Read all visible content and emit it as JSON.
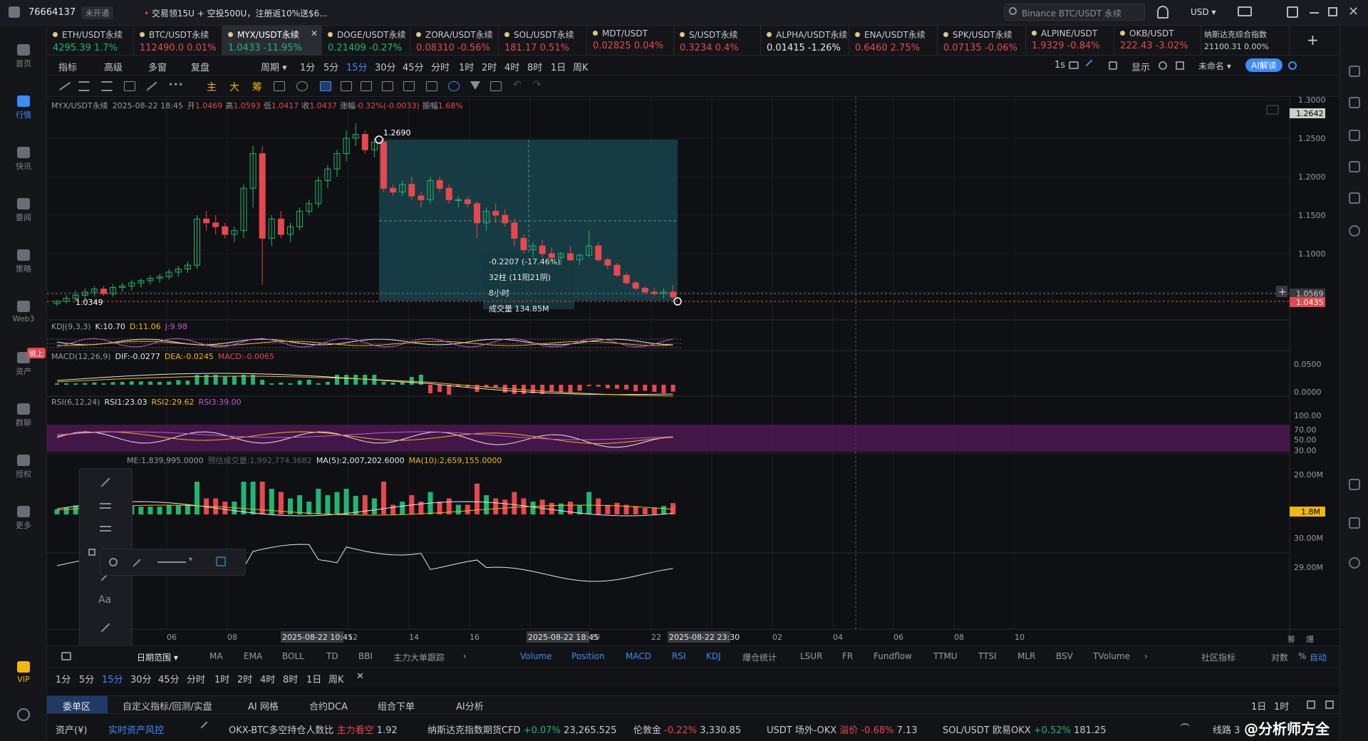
{
  "titlebar": {
    "account": "76664137",
    "badge": "未开通",
    "promo": "交易领15U + 空投500U，注册返10%送$6...",
    "search_placeholder": "Binance BTC/USDT 永续",
    "currency": "USD"
  },
  "leftnav": [
    {
      "label": "首页",
      "icon": "home-icon"
    },
    {
      "label": "行情",
      "icon": "market-icon",
      "active": true
    },
    {
      "label": "快讯",
      "icon": "news-flash-icon"
    },
    {
      "label": "要闻",
      "icon": "headlines-icon"
    },
    {
      "label": "策略",
      "icon": "strategy-icon"
    },
    {
      "label": "Web3",
      "icon": "web3-icon"
    },
    {
      "label": "资产",
      "icon": "wallet-icon",
      "tag": "链上"
    },
    {
      "label": "群聊",
      "icon": "chat-icon"
    },
    {
      "label": "授权",
      "icon": "authorize-icon"
    },
    {
      "label": "更多",
      "icon": "more-icon"
    },
    {
      "label": "VIP",
      "icon": "vip-icon"
    }
  ],
  "tickers": [
    {
      "name": "ETH/USDT永续",
      "price": "4295.39",
      "change": "1.7%",
      "dir": "up"
    },
    {
      "name": "BTC/USDT永续",
      "price": "112490.0",
      "change": "0.01%",
      "dir": "dn"
    },
    {
      "name": "MYX/USDT永续",
      "price": "1.0433",
      "change": "-11.95%",
      "dir": "up",
      "selected": true
    },
    {
      "name": "DOGE/USDT永续",
      "price": "0.21409",
      "change": "-0.27%",
      "dir": "up"
    },
    {
      "name": "ZORA/USDT永续",
      "price": "0.08310",
      "change": "-0.56%",
      "dir": "dn"
    },
    {
      "name": "SOL/USDT永续",
      "price": "181.17",
      "change": "0.51%",
      "dir": "dn"
    },
    {
      "name": "MDT/USDT",
      "price": "0.02825",
      "change": "0.04%",
      "dir": "dn"
    },
    {
      "name": "S/USDT永续",
      "price": "0.3234",
      "change": "0.4%",
      "dir": "dn"
    },
    {
      "name": "ALPHA/USDT永续",
      "price": "0.01415",
      "change": "-1.26%",
      "dir": "neutral"
    },
    {
      "name": "ENA/USDT永续",
      "price": "0.6460",
      "change": "2.75%",
      "dir": "dn"
    },
    {
      "name": "SPK/USDT永续",
      "price": "0.07135",
      "change": "-0.06%",
      "dir": "dn"
    },
    {
      "name": "ALPINE/USDT",
      "price": "1.9329",
      "change": "-0.84%",
      "dir": "dn"
    },
    {
      "name": "OKB/USDT",
      "price": "222.43",
      "change": "-3.02%",
      "dir": "dn"
    },
    {
      "name": "纳斯达克综合指数",
      "price": "21100.31",
      "change": "0.00%",
      "dir": "neutral"
    }
  ],
  "toolbar1": {
    "items": [
      "指标",
      "高级",
      "多窗",
      "复盘",
      "周期"
    ],
    "timeframes": [
      "1分",
      "5分",
      "15分",
      "30分",
      "45分",
      "分时",
      "1时",
      "2时",
      "4时",
      "8时",
      "1日",
      "周K"
    ],
    "selected_tf": "15分",
    "right": [
      "1s",
      "显示",
      "未命名",
      "AI解读"
    ]
  },
  "toolbar2": {
    "tags": [
      "主",
      "大",
      "筹"
    ]
  },
  "chart": {
    "symbol_line": {
      "symbol": "MYX/USDT永续",
      "time": "2025-08-22 18:45",
      "open_l": "开",
      "open": "1.0469",
      "high_l": "高",
      "high": "1.0593",
      "low_l": "低",
      "low": "1.0417",
      "close_l": "收",
      "close": "1.0437",
      "chg_l": "涨幅",
      "chg": "-0.32%(-0.0033)",
      "amp_l": "振幅",
      "amp": "1.68%"
    },
    "price_axis": [
      "1.3000",
      "1.2500",
      "1.2000",
      "1.1500",
      "1.1000",
      "1.0500"
    ],
    "price_tags": {
      "high_mark": "1.2642",
      "ref": "1.0569",
      "last": "1.0435"
    },
    "hi_label": "1.2690",
    "lo_label": "1.0349",
    "measure": {
      "l1": "-0.2207 (-17.46%)",
      "l2": "32柱 (11阳21阴)",
      "l3": "8小时",
      "l4": "成交量 134.85M"
    },
    "kdj": {
      "name": "KDJ(9,3,3)",
      "k": "K:10.70",
      "d": "D:11.06",
      "j": "J:9.98"
    },
    "macd": {
      "name": "MACD(12,26,9)",
      "dif": "DIF:-0.0277",
      "dea": "DEA:-0.0245",
      "macd": "MACD:-0.0065",
      "axis": [
        "0.0500",
        "0.0000"
      ]
    },
    "rsi": {
      "name": "RSI(6,12,24)",
      "r1": "RSI1:23.03",
      "r2": "RSI2:29.62",
      "r3": "RSI3:39.00",
      "axis": [
        "100.00",
        "70.00",
        "50.00",
        "30.00"
      ]
    },
    "vol": {
      "v": "ME:1,839,995.0000",
      "est": "预估成交量:1,992,774.3682",
      "ma5": "MA(5):2,007,202.6000",
      "ma10": "MA(10):2,659,155.0000",
      "axis": [
        "20.00M"
      ],
      "tag": "1.8M"
    },
    "pos": {
      "axis": [
        "30.00M",
        "29.00M"
      ]
    },
    "time_axis": [
      "06",
      "08",
      "2025-08-22 10:45",
      "12",
      "14",
      "16",
      "2025-08-22 18:45",
      "20",
      "22",
      "2025-08-22 23:30",
      "02",
      "04",
      "06",
      "08",
      "10"
    ],
    "corner": [
      "筹",
      "爆"
    ]
  },
  "chart_data": {
    "type": "candlestick",
    "symbol": "MYX/USDT永续",
    "interval": "15分",
    "ylim": [
      1.02,
      1.31
    ],
    "candles": [
      [
        1.035,
        1.04,
        1.032,
        1.038
      ],
      [
        1.038,
        1.046,
        1.035,
        1.042
      ],
      [
        1.042,
        1.052,
        1.038,
        1.046
      ],
      [
        1.046,
        1.055,
        1.041,
        1.05
      ],
      [
        1.05,
        1.058,
        1.044,
        1.054
      ],
      [
        1.054,
        1.058,
        1.045,
        1.048
      ],
      [
        1.048,
        1.06,
        1.044,
        1.056
      ],
      [
        1.056,
        1.062,
        1.05,
        1.058
      ],
      [
        1.058,
        1.066,
        1.052,
        1.062
      ],
      [
        1.062,
        1.068,
        1.056,
        1.065
      ],
      [
        1.065,
        1.072,
        1.06,
        1.068
      ],
      [
        1.068,
        1.074,
        1.062,
        1.07
      ],
      [
        1.07,
        1.08,
        1.066,
        1.076
      ],
      [
        1.076,
        1.084,
        1.07,
        1.08
      ],
      [
        1.08,
        1.09,
        1.075,
        1.085
      ],
      [
        1.085,
        1.15,
        1.08,
        1.145
      ],
      [
        1.145,
        1.155,
        1.13,
        1.14
      ],
      [
        1.14,
        1.15,
        1.125,
        1.135
      ],
      [
        1.135,
        1.14,
        1.12,
        1.125
      ],
      [
        1.125,
        1.135,
        1.115,
        1.13
      ],
      [
        1.13,
        1.19,
        1.12,
        1.185
      ],
      [
        1.185,
        1.24,
        1.16,
        1.23
      ],
      [
        1.23,
        1.24,
        1.06,
        1.12
      ],
      [
        1.12,
        1.15,
        1.11,
        1.145
      ],
      [
        1.145,
        1.155,
        1.12,
        1.125
      ],
      [
        1.125,
        1.14,
        1.115,
        1.135
      ],
      [
        1.135,
        1.16,
        1.13,
        1.155
      ],
      [
        1.155,
        1.17,
        1.15,
        1.165
      ],
      [
        1.165,
        1.2,
        1.16,
        1.195
      ],
      [
        1.195,
        1.215,
        1.185,
        1.21
      ],
      [
        1.21,
        1.235,
        1.2,
        1.23
      ],
      [
        1.23,
        1.26,
        1.22,
        1.25
      ],
      [
        1.25,
        1.269,
        1.24,
        1.255
      ],
      [
        1.255,
        1.26,
        1.23,
        1.235
      ],
      [
        1.235,
        1.25,
        1.225,
        1.245
      ],
      [
        1.245,
        1.25,
        1.18,
        1.185
      ],
      [
        1.185,
        1.19,
        1.175,
        1.18
      ],
      [
        1.18,
        1.195,
        1.175,
        1.19
      ],
      [
        1.19,
        1.2,
        1.17,
        1.175
      ],
      [
        1.175,
        1.18,
        1.16,
        1.17
      ],
      [
        1.17,
        1.2,
        1.165,
        1.195
      ],
      [
        1.195,
        1.2,
        1.18,
        1.185
      ],
      [
        1.185,
        1.19,
        1.165,
        1.17
      ],
      [
        1.17,
        1.175,
        1.16,
        1.17
      ],
      [
        1.17,
        1.175,
        1.16,
        1.165
      ],
      [
        1.165,
        1.168,
        1.12,
        1.14
      ],
      [
        1.14,
        1.16,
        1.13,
        1.155
      ],
      [
        1.155,
        1.165,
        1.14,
        1.15
      ],
      [
        1.15,
        1.158,
        1.135,
        1.14
      ],
      [
        1.14,
        1.145,
        1.11,
        1.12
      ],
      [
        1.12,
        1.125,
        1.1,
        1.105
      ],
      [
        1.105,
        1.115,
        1.095,
        1.11
      ],
      [
        1.11,
        1.118,
        1.095,
        1.1
      ],
      [
        1.1,
        1.108,
        1.09,
        1.095
      ],
      [
        1.095,
        1.102,
        1.085,
        1.1
      ],
      [
        1.1,
        1.11,
        1.09,
        1.092
      ],
      [
        1.092,
        1.1,
        1.085,
        1.098
      ],
      [
        1.098,
        1.13,
        1.095,
        1.11
      ],
      [
        1.11,
        1.115,
        1.09,
        1.092
      ],
      [
        1.092,
        1.095,
        1.08,
        1.085
      ],
      [
        1.085,
        1.088,
        1.07,
        1.072
      ],
      [
        1.072,
        1.075,
        1.06,
        1.062
      ],
      [
        1.062,
        1.065,
        1.052,
        1.055
      ],
      [
        1.055,
        1.058,
        1.048,
        1.05
      ],
      [
        1.05,
        1.056,
        1.045,
        1.048
      ],
      [
        1.048,
        1.055,
        1.042,
        1.05
      ],
      [
        1.05,
        1.0593,
        1.0417,
        1.0437
      ]
    ]
  },
  "bottom": {
    "tabs_left": [
      "日期范围",
      "MA",
      "EMA",
      "BOLL",
      "TD",
      "BBI",
      "主力大单跟踪"
    ],
    "tabs_right": [
      "Volume",
      "Position",
      "MACD",
      "RSI",
      "KDJ",
      "爆仓统计",
      "LSUR",
      "FR",
      "Fundflow",
      "TTMU",
      "TTSI",
      "MLR",
      "BSV",
      "TVolume"
    ],
    "right_items": [
      "社区指标",
      "对数",
      "%",
      "自动"
    ],
    "timeframes": [
      "1分",
      "5分",
      "15分",
      "30分",
      "45分",
      "分时",
      "1时",
      "2时",
      "4时",
      "8时",
      "1日",
      "周K"
    ],
    "selected_tf": "15分",
    "panel_tabs": [
      "委单区",
      "自定义指标/回测/实盘",
      "AI 网格",
      "合约DCA",
      "组合下单",
      "AI分析"
    ],
    "panel_right": [
      "1日",
      "1时"
    ]
  },
  "status": [
    {
      "label": "资产(¥)",
      "value": "",
      "color": "#c8cad0"
    },
    {
      "label": "实时资产风控",
      "value": "",
      "color": "#3d8bfd"
    },
    {
      "label": "OKX-BTC多空持仓人数比",
      "value": "1.92",
      "tag": "主力看空",
      "tagcolor": "#e8474f"
    },
    {
      "label": "纳斯达克指数期货CFD",
      "value": "23,265.525",
      "tag": "+0.07%",
      "tagcolor": "#21b573"
    },
    {
      "label": "伦敦金",
      "value": "3,330.85",
      "tag": "-0.22%",
      "tagcolor": "#e8474f"
    },
    {
      "label": "USDT 场外-OKX",
      "value": "7.13",
      "tag": "溢价 -0.68%",
      "tagcolor": "#e8474f"
    },
    {
      "label": "SOL/USDT 欧易OKX",
      "value": "181.25",
      "tag": "+0.52%",
      "tagcolor": "#21b573"
    }
  ],
  "status_right": "线路 3",
  "watermark": "@分析师方全",
  "colors": {
    "up": "#21b573",
    "down": "#e8474f",
    "accent": "#3d8bfd",
    "measure_box": "#1e4e55"
  }
}
